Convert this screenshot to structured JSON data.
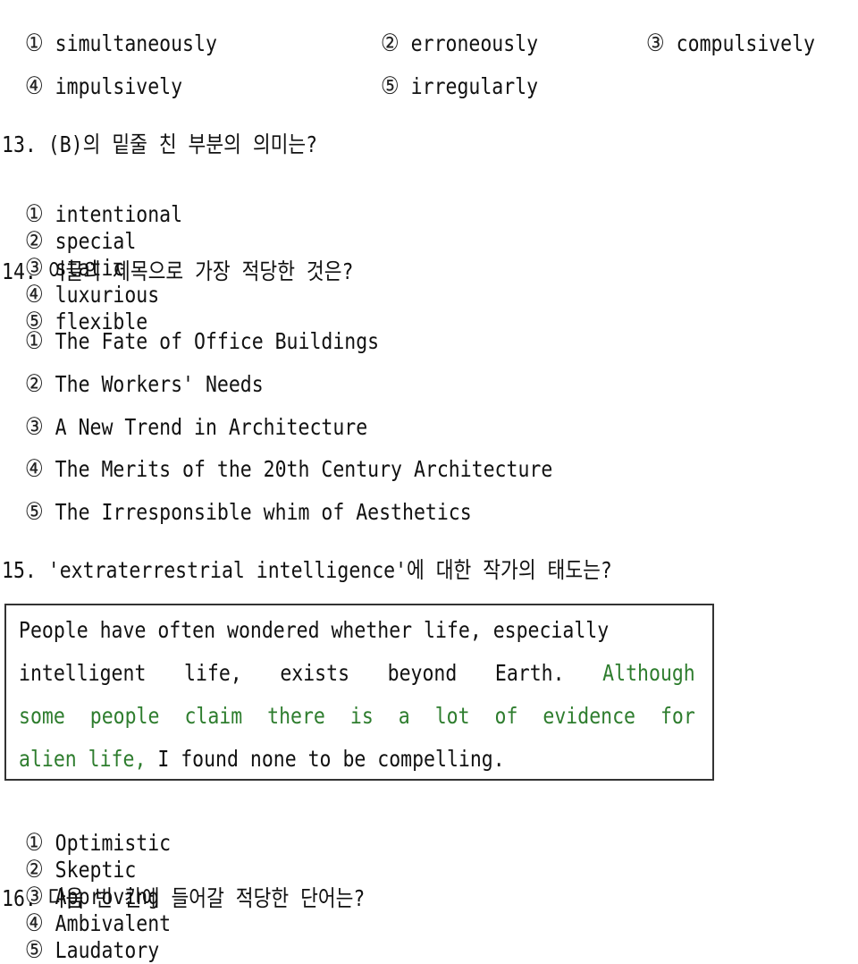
{
  "q12_options": [
    {
      "num": "①",
      "text": "simultaneously"
    },
    {
      "num": "②",
      "text": "erroneously"
    },
    {
      "num": "③",
      "text": "compulsively"
    },
    {
      "num": "④",
      "text": "impulsively"
    },
    {
      "num": "⑤",
      "text": "irregularly"
    }
  ],
  "q13": {
    "title": "13. (B)의 밑줄 친 부분의 의미는?",
    "options": [
      {
        "num": "①",
        "text": "intentional"
      },
      {
        "num": "②",
        "text": "special"
      },
      {
        "num": "③",
        "text": "static"
      },
      {
        "num": "④",
        "text": "luxurious"
      },
      {
        "num": "⑤",
        "text": "flexible"
      }
    ]
  },
  "q14": {
    "title": "14. 이글의 제목으로 가장 적당한 것은?",
    "options": [
      {
        "num": "①",
        "text": "The Fate of Office Buildings"
      },
      {
        "num": "②",
        "text": "The Workers' Needs"
      },
      {
        "num": "③",
        "text": "A New Trend in Architecture"
      },
      {
        "num": "④",
        "text": "The Merits of the 20th Century Architecture"
      },
      {
        "num": "⑤",
        "text": "The Irresponsible whim of Aesthetics"
      }
    ]
  },
  "q15": {
    "title": "15. 'extraterrestrial intelligence'에 대한 작가의 태도는?",
    "passage": {
      "line1": "People have often wondered whether life, especially",
      "line2_black": [
        "intelligent",
        "life,",
        "exists",
        "beyond",
        "Earth."
      ],
      "line2_green": "Although",
      "line3_green": [
        "some",
        "people",
        "claim",
        "there",
        "is",
        "a",
        "lot",
        "of",
        "evidence",
        "for"
      ],
      "line4_green": "alien life,",
      "line4_black": " I found none to be compelling."
    },
    "highlight_color": "#2e7d2e",
    "options": [
      {
        "num": "①",
        "text": "Optimistic"
      },
      {
        "num": "②",
        "text": "Skeptic"
      },
      {
        "num": "③",
        "text": "Approving"
      },
      {
        "num": "④",
        "text": "Ambivalent"
      },
      {
        "num": "⑤",
        "text": "Laudatory"
      }
    ]
  },
  "q16": {
    "title": "16. 다음 빈 칸에 들어갈 적당한 단어는?"
  }
}
